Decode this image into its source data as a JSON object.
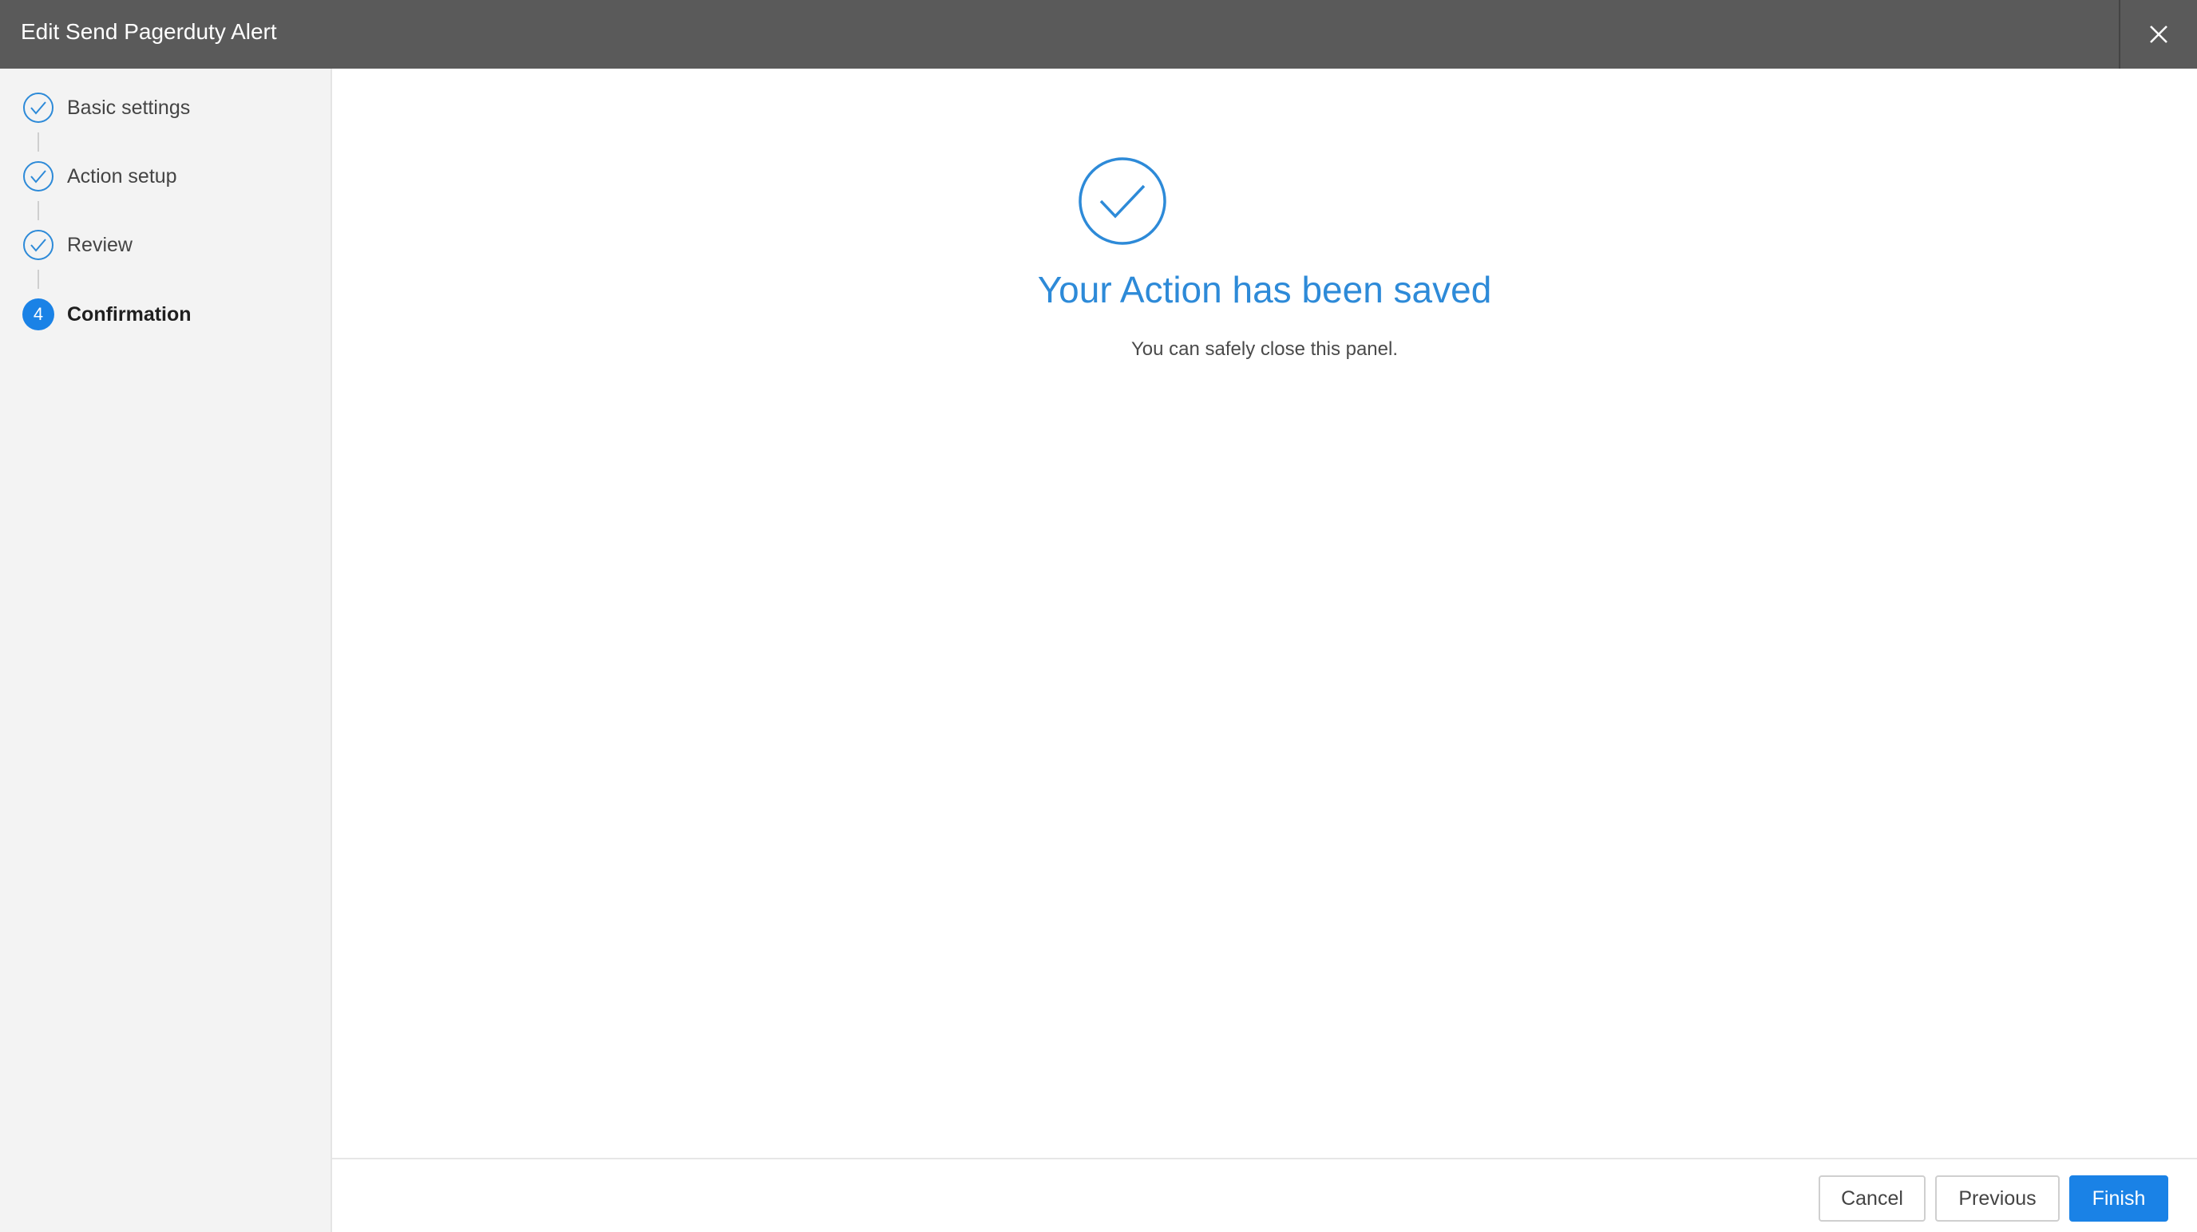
{
  "header": {
    "title": "Edit Send Pagerduty Alert",
    "close_icon": "close-icon"
  },
  "sidebar": {
    "steps": [
      {
        "label": "Basic settings",
        "status": "complete",
        "icon": "check-circle-icon"
      },
      {
        "label": "Action setup",
        "status": "complete",
        "icon": "check-circle-icon"
      },
      {
        "label": "Review",
        "status": "complete",
        "icon": "check-circle-icon"
      },
      {
        "label": "Confirmation",
        "status": "active",
        "number": "4"
      }
    ]
  },
  "main": {
    "icon": "success-check-icon",
    "title": "Your Action has been saved",
    "subtitle": "You can safely close this panel."
  },
  "footer": {
    "cancel_label": "Cancel",
    "previous_label": "Previous",
    "finish_label": "Finish"
  },
  "colors": {
    "header_bg": "#5a5a5a",
    "accent": "#1a82e6",
    "success_text": "#2d8ad8",
    "sidebar_bg": "#f3f3f3"
  }
}
